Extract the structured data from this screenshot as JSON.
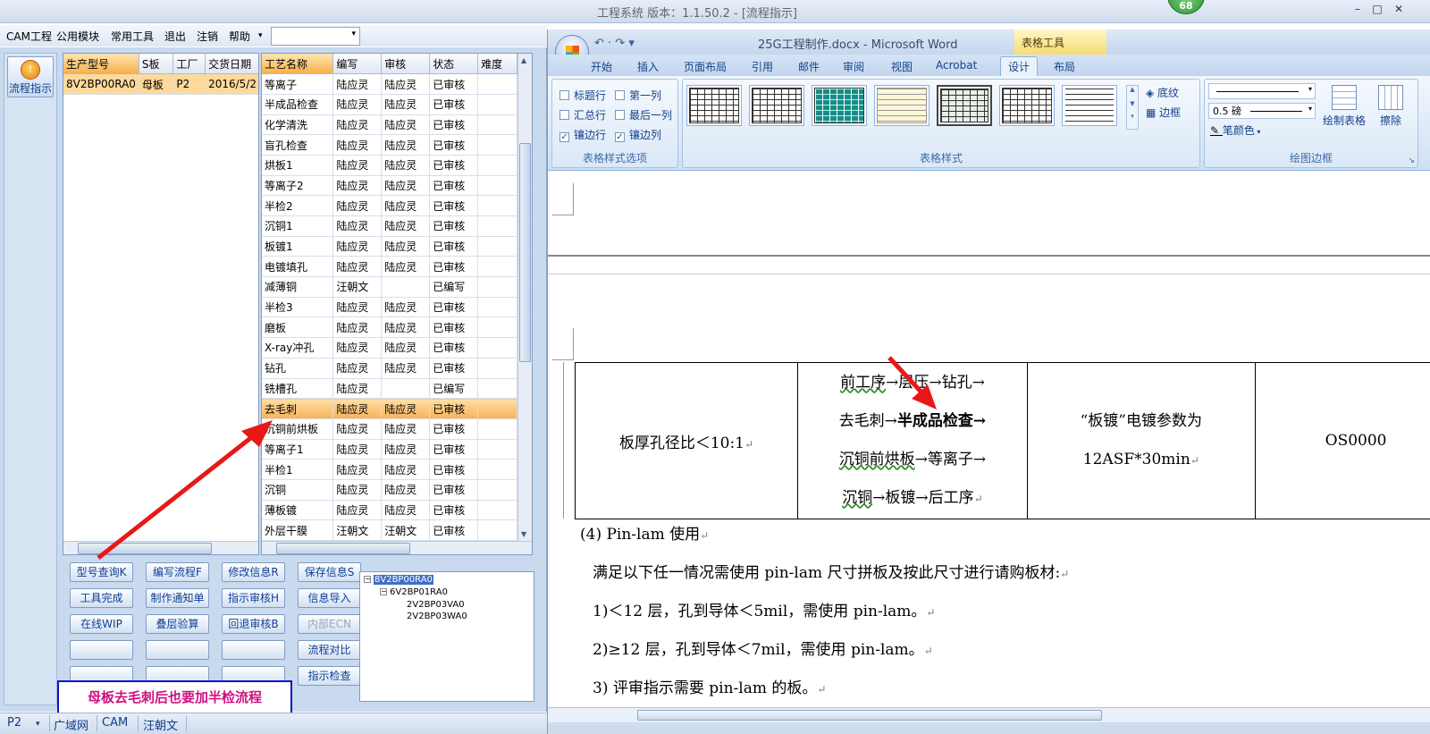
{
  "app": {
    "title": "工程系统  版本：1.1.50.2 - [流程指示]",
    "badge": "68",
    "win_min": "–",
    "win_max": "□",
    "win_close": "✕"
  },
  "menu": {
    "items": [
      "CAM工程",
      "公用模块",
      "常用工具",
      "退出",
      "注销",
      "帮助"
    ],
    "more": "▾",
    "dropdown_value": "",
    "dropdown_arrow": "▾"
  },
  "sidebar": {
    "flow_button": "流程指示",
    "flow_icon": "!"
  },
  "left_grid": {
    "headers": [
      "生产型号",
      "S板",
      "工厂",
      "交货日期"
    ],
    "rows": [
      [
        "8V2BP00RA0",
        "母板",
        "P2",
        "2016/5/2"
      ]
    ]
  },
  "process_grid": {
    "headers": [
      "工艺名称",
      "编写",
      "审核",
      "状态",
      "难度"
    ],
    "rows": [
      [
        "等离子",
        "陆应灵",
        "陆应灵",
        "已审核",
        ""
      ],
      [
        "半成品检查",
        "陆应灵",
        "陆应灵",
        "已审核",
        ""
      ],
      [
        "化学清洗",
        "陆应灵",
        "陆应灵",
        "已审核",
        ""
      ],
      [
        "盲孔检查",
        "陆应灵",
        "陆应灵",
        "已审核",
        ""
      ],
      [
        "烘板1",
        "陆应灵",
        "陆应灵",
        "已审核",
        ""
      ],
      [
        "等离子2",
        "陆应灵",
        "陆应灵",
        "已审核",
        ""
      ],
      [
        "半检2",
        "陆应灵",
        "陆应灵",
        "已审核",
        ""
      ],
      [
        "沉铜1",
        "陆应灵",
        "陆应灵",
        "已审核",
        ""
      ],
      [
        "板镀1",
        "陆应灵",
        "陆应灵",
        "已审核",
        ""
      ],
      [
        "电镀填孔",
        "陆应灵",
        "陆应灵",
        "已审核",
        ""
      ],
      [
        "减薄铜",
        "汪朝文",
        "",
        "已编写",
        ""
      ],
      [
        "半检3",
        "陆应灵",
        "陆应灵",
        "已审核",
        ""
      ],
      [
        "磨板",
        "陆应灵",
        "陆应灵",
        "已审核",
        ""
      ],
      [
        "X-ray冲孔",
        "陆应灵",
        "陆应灵",
        "已审核",
        ""
      ],
      [
        "钻孔",
        "陆应灵",
        "陆应灵",
        "已审核",
        ""
      ],
      [
        "铣槽孔",
        "陆应灵",
        "",
        "已编写",
        ""
      ],
      [
        "去毛刺",
        "陆应灵",
        "陆应灵",
        "已审核",
        ""
      ],
      [
        "沉铜前烘板",
        "陆应灵",
        "陆应灵",
        "已审核",
        ""
      ],
      [
        "等离子1",
        "陆应灵",
        "陆应灵",
        "已审核",
        ""
      ],
      [
        "半检1",
        "陆应灵",
        "陆应灵",
        "已审核",
        ""
      ],
      [
        "沉铜",
        "陆应灵",
        "陆应灵",
        "已审核",
        ""
      ],
      [
        "薄板镀",
        "陆应灵",
        "陆应灵",
        "已审核",
        ""
      ],
      [
        "外层干膜",
        "汪朝文",
        "汪朝文",
        "已审核",
        ""
      ]
    ],
    "selected_index": 16
  },
  "buttons": [
    {
      "label": "型号查询K",
      "enabled": true
    },
    {
      "label": "编写流程F",
      "enabled": true
    },
    {
      "label": "修改信息R",
      "enabled": true
    },
    {
      "label": "保存信息S",
      "enabled": true
    },
    {
      "label": "工具完成",
      "enabled": true
    },
    {
      "label": "制作通知单",
      "enabled": true
    },
    {
      "label": "指示审核H",
      "enabled": true
    },
    {
      "label": "信息导入",
      "enabled": true
    },
    {
      "label": "在线WIP",
      "enabled": true
    },
    {
      "label": "叠层验算",
      "enabled": true
    },
    {
      "label": "回退审核B",
      "enabled": true
    },
    {
      "label": "内部ECN",
      "enabled": false
    },
    {
      "label": "",
      "enabled": true
    },
    {
      "label": "",
      "enabled": true
    },
    {
      "label": "",
      "enabled": true
    },
    {
      "label": "流程对比",
      "enabled": true
    },
    {
      "label": "",
      "enabled": true
    },
    {
      "label": "",
      "enabled": true
    },
    {
      "label": "",
      "enabled": true
    },
    {
      "label": "指示检查",
      "enabled": true
    }
  ],
  "tree": {
    "root": "8V2BP00RA0",
    "child": "6V2BP01RA0",
    "leaves": [
      "2V2BP03VA0",
      "2V2BP03WA0"
    ],
    "minus": "−"
  },
  "annotation": {
    "text": "母板去毛刺后也要加半检流程"
  },
  "statusbar": {
    "items": [
      "P2",
      "广域网",
      "CAM",
      "汪朝文"
    ],
    "arrow": "▾"
  },
  "word": {
    "title": "25G工程制作.docx - Microsoft Word",
    "context_tab": "表格工具",
    "qat": "↶ · ↷  ▾",
    "tabs": [
      "开始",
      "插入",
      "页面布局",
      "引用",
      "邮件",
      "审阅",
      "视图",
      "Acrobat",
      "设计",
      "布局"
    ],
    "active_tab": "设计",
    "options": [
      {
        "label": "标题行",
        "checked": false
      },
      {
        "label": "汇总行",
        "checked": false
      },
      {
        "label": "镶边行",
        "checked": true
      },
      {
        "label": "第一列",
        "checked": false
      },
      {
        "label": "最后一列",
        "checked": false
      },
      {
        "label": "镶边列",
        "checked": true
      }
    ],
    "check_mark": "✓",
    "groups": [
      "表格样式选项",
      "表格样式",
      "绘图边框"
    ],
    "shading": "底纹",
    "border": "边框",
    "pen_weight": "0.5 磅",
    "pen_color": "笔颜色",
    "draw_table": "绘制表格",
    "eraser": "擦除",
    "scroll_up": "▲",
    "scroll_down": "▼",
    "scroll_more": "▾",
    "dd_arrow": "▾",
    "launcher": "↘"
  },
  "doc": {
    "table": {
      "c1": "板厚孔径比＜10:1",
      "flow": [
        {
          "pre": "前工序",
          "mid": "→层压→钻孔→",
          "bold": ""
        },
        {
          "pre": "去毛刺→",
          "mid": "",
          "bold": "半成品检查→"
        },
        {
          "pre": "沉铜前烘板",
          "mid": "→等离子→",
          "bold": ""
        },
        {
          "pre": "沉铜",
          "mid": "→板镀→后工序",
          "bold": ""
        }
      ],
      "c3a": "“板镀”电镀参数为",
      "c3b": "12ASF*30min",
      "c4": "OS0000"
    },
    "paras": [
      "(4) Pin-lam 使用",
      "满足以下任一情况需使用 pin-lam 尺寸拼板及按此尺寸进行请购板材:",
      "1)＜12 层，孔到导体＜5mil，需使用 pin-lam。",
      "2)≥12 层，孔到导体＜7mil，需使用 pin-lam。",
      "3) 评审指示需要 pin-lam  的板。"
    ],
    "para_mark": "↵"
  },
  "colors": {
    "accent": "#e02020",
    "selection": "#f8b25a",
    "note_text": "#d01080",
    "note_border": "#1410c8"
  }
}
